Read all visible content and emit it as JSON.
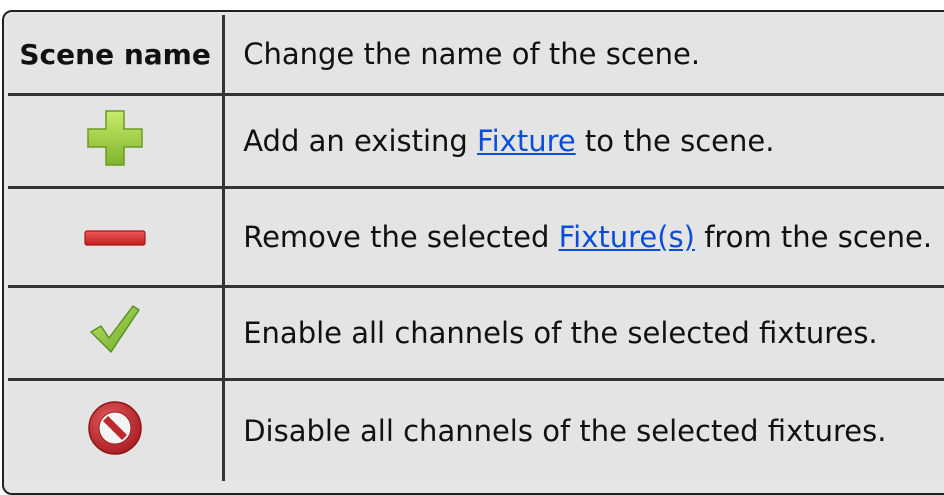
{
  "table": {
    "rows": [
      {
        "key_label": "Scene name",
        "description": "Change the name of the scene."
      },
      {
        "icon": "add-plus-icon",
        "desc_before": "Add an existing ",
        "link_text": "Fixture",
        "desc_after": " to the scene."
      },
      {
        "icon": "remove-minus-icon",
        "desc_before": "Remove the selected ",
        "link_text": "Fixture(s)",
        "desc_after": " from the scene."
      },
      {
        "icon": "checkmark-icon",
        "description": "Enable all channels of the selected fixtures."
      },
      {
        "icon": "disable-icon",
        "description": "Disable all channels of the selected fixtures."
      }
    ]
  },
  "colors": {
    "link": "#0a4fdc",
    "add_icon": "#9ccf3a",
    "remove_icon": "#d42a2a",
    "check_icon": "#8cc63e",
    "disable_icon": "#c0282d"
  }
}
